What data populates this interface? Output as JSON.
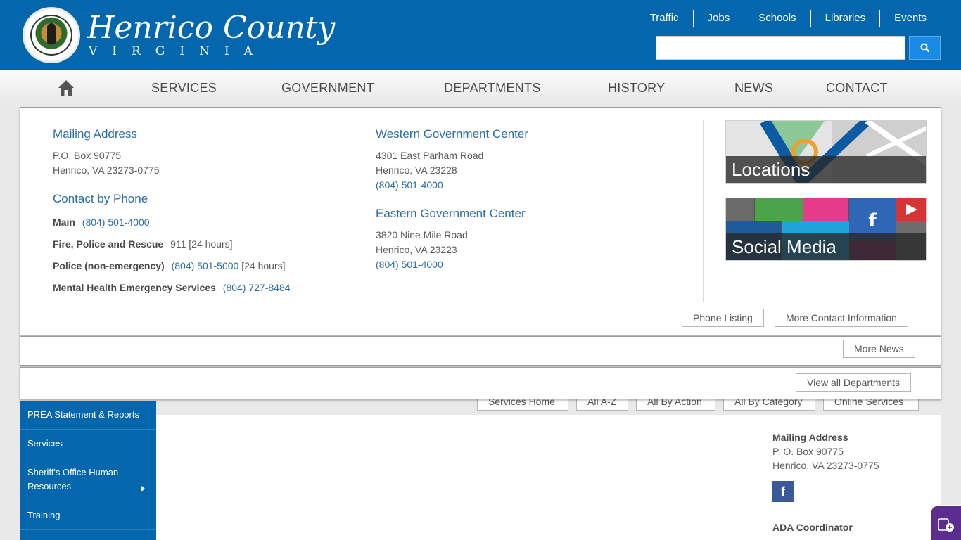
{
  "header": {
    "site_title": "Henrico County",
    "site_subtitle": "VIRGINIA",
    "seal_text": "COUNTY OF HENRICO, VIRGINIA",
    "utility_links": [
      "Traffic",
      "Jobs",
      "Schools",
      "Libraries",
      "Events"
    ],
    "search": {
      "value": "",
      "placeholder": ""
    }
  },
  "nav": {
    "items": [
      "SERVICES",
      "GOVERNMENT",
      "DEPARTMENTS",
      "HISTORY",
      "NEWS",
      "CONTACT"
    ]
  },
  "contact_panel": {
    "mailing": {
      "heading": "Mailing Address",
      "line1": "P.O. Box 90775",
      "line2": "Henrico, VA 23273-0775"
    },
    "phone_heading": "Contact by Phone",
    "phones": [
      {
        "label": "Main",
        "number": "(804) 501-4000",
        "note": ""
      },
      {
        "label": "Fire, Police and Rescue",
        "number": "",
        "plain": "911 [24 hours]"
      },
      {
        "label": "Police (non-emergency)",
        "number": "(804) 501-5000",
        "note": "[24 hours]"
      },
      {
        "label": "Mental Health Emergency Services",
        "number": "(804) 727-8484",
        "note": ""
      }
    ],
    "western": {
      "heading": "Western Government Center",
      "line1": "4301 East Parham Road",
      "line2": "Henrico, VA 23228",
      "phone": "(804) 501-4000"
    },
    "eastern": {
      "heading": "Eastern Government Center",
      "line1": "3820 Nine Mile Road",
      "line2": "Henrico, VA 23223",
      "phone": "(804) 501-4000"
    },
    "tiles": {
      "locations": "Locations",
      "social": "Social Media"
    },
    "buttons": {
      "phone_listing": "Phone Listing",
      "more_contact": "More Contact Information"
    }
  },
  "news_strip": {
    "more_news": "More News"
  },
  "departments_strip": {
    "view_all": "View all Departments"
  },
  "background_page": {
    "service_buttons": [
      "Services Home",
      "All A-Z",
      "All By Action",
      "All By Category",
      "Online Services"
    ],
    "sidebar_items": [
      "PREA Statement & Reports",
      "Services",
      "Sheriff's Office Human Resources",
      "Training"
    ],
    "right_col": {
      "mailing_heading": "Mailing Address",
      "mailing_line1": "P. O. Box 90775",
      "mailing_line2": "Henrico, VA 23273-0775",
      "ada_heading": "ADA Coordinator"
    }
  },
  "colors": {
    "brand_blue": "#0467ad",
    "link_blue": "#2f6ca4",
    "search_blue": "#1a8ae6",
    "accessibility_purple": "#5b2d8e"
  }
}
